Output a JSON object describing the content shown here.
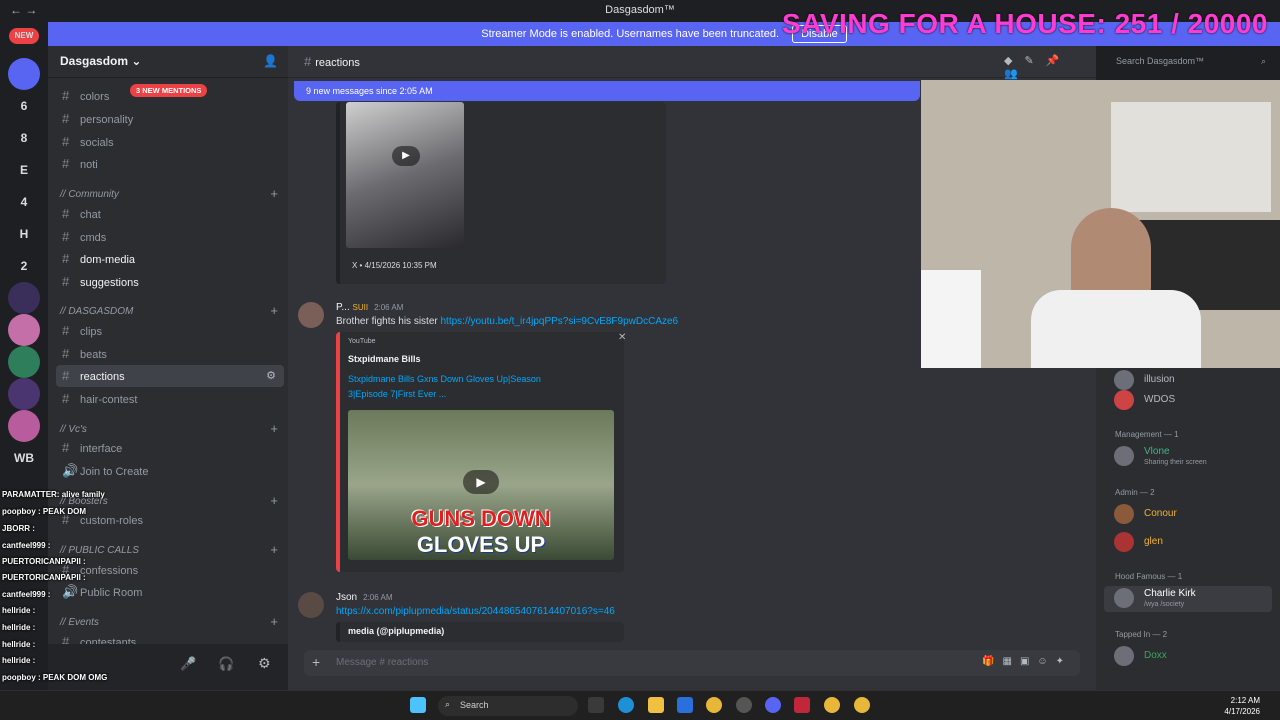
{
  "titlebar": {
    "title": "Dasgasdom™",
    "nav": "←  →"
  },
  "overlay": {
    "goal_text": "SAVING FOR A HOUSE: 251 / 20000"
  },
  "banner": {
    "text": "Streamer Mode is enabled. Usernames have been truncated.",
    "button": "Disable"
  },
  "guilds": [
    "NEW",
    "6",
    "8",
    "E",
    "4",
    "H",
    "2",
    "WB"
  ],
  "server": {
    "name": "Dasgasdom",
    "mentions_badge": "3 NEW MENTIONS",
    "channels": [
      {
        "name": "colors"
      },
      {
        "name": "personality"
      },
      {
        "name": "socials"
      },
      {
        "name": "noti"
      }
    ],
    "cat_community": "// Community",
    "community": [
      {
        "name": "chat"
      },
      {
        "name": "cmds"
      },
      {
        "name": "dom-media"
      },
      {
        "name": "suggestions"
      }
    ],
    "cat_dasgasdom": "// DASGASDOM",
    "dasgasdom": [
      {
        "name": "clips"
      },
      {
        "name": "beats"
      },
      {
        "name": "reactions"
      },
      {
        "name": "hair-contest"
      }
    ],
    "cat_vcs": "// Vc's",
    "vcs": [
      {
        "name": "interface"
      },
      {
        "name": "Join to Create"
      }
    ],
    "cat_boosters": "// Boosters",
    "boosters": [
      {
        "name": "custom-roles"
      }
    ],
    "cat_public_calls": "// PUBLIC CALLS",
    "public_calls": [
      {
        "name": "confessions"
      },
      {
        "name": "Public Room"
      }
    ],
    "cat_events": "// Events",
    "events": [
      {
        "name": "contestants"
      }
    ]
  },
  "channel": {
    "name": "reactions",
    "new_messages": "9 new messages since 2:05 AM",
    "search_placeholder": "Search Dasgasdom™"
  },
  "messages": [
    {
      "source": "X • 4/15/2026 10:35 PM"
    },
    {
      "author": "P...",
      "tag": "SUII",
      "time": "2:06 AM",
      "text": "Brother fights his sister",
      "link": "https://youtu.be/t_ir4jpqPPs?si=9CvE8F9pwDcCAze6",
      "embed": {
        "provider": "YouTube",
        "author": "Stxpidmane Bills",
        "title_line1": "Stxpidmane Bills Gxns Down Gloves Up|Season",
        "title_line2": "3|Episode 7|First Ever ...",
        "thumb_text_1": "GUNS DOWN",
        "thumb_text_2": "GLOVES UP"
      }
    },
    {
      "author": "Json",
      "time": "2:06 AM",
      "link": "https://x.com/piplupmedia/status/2044865407614407016?s=46",
      "embed_title": "media (@piplupmedia)"
    }
  ],
  "input": {
    "placeholder": "Message # reactions"
  },
  "members": {
    "top_names": [
      "illusion",
      "WDOS"
    ],
    "groups": [
      {
        "label": "Management — 1",
        "members": [
          {
            "name": "Vlone",
            "status": "Sharing their screen",
            "color": "#43b581"
          }
        ]
      },
      {
        "label": "Admin — 2",
        "members": [
          {
            "name": "Conour",
            "color": "#f0b232"
          },
          {
            "name": "glen",
            "color": "#f0b232"
          }
        ]
      },
      {
        "label": "Hood Famous — 1",
        "members": [
          {
            "name": "Charlie Kirk",
            "status": "/wya /society",
            "color": "#ffffff"
          }
        ]
      },
      {
        "label": "Tapped In — 2",
        "members": [
          {
            "name": "Doxx",
            "color": "#3ba55d"
          }
        ]
      }
    ]
  },
  "chat_overlay": [
    "PARAMATTER: alive family",
    "poopboy : PEAK DOM",
    "JBORR :",
    "cantfeel999 :",
    "PUERTORICANPAPII :",
    "PUERTORICANPAPII :",
    "cantfeel999 :",
    "hellride :",
    "hellride :",
    "hellride :",
    "hellride :",
    "poopboy : PEAK DOM OMG"
  ],
  "taskbar": {
    "search": "Search",
    "time": "2:12 AM",
    "date": "4/17/2026"
  },
  "colors": {
    "blurple": "#5865f2",
    "red": "#ed4245",
    "link": "#00a8fc",
    "overlay_pink": "#ff3bd4"
  }
}
